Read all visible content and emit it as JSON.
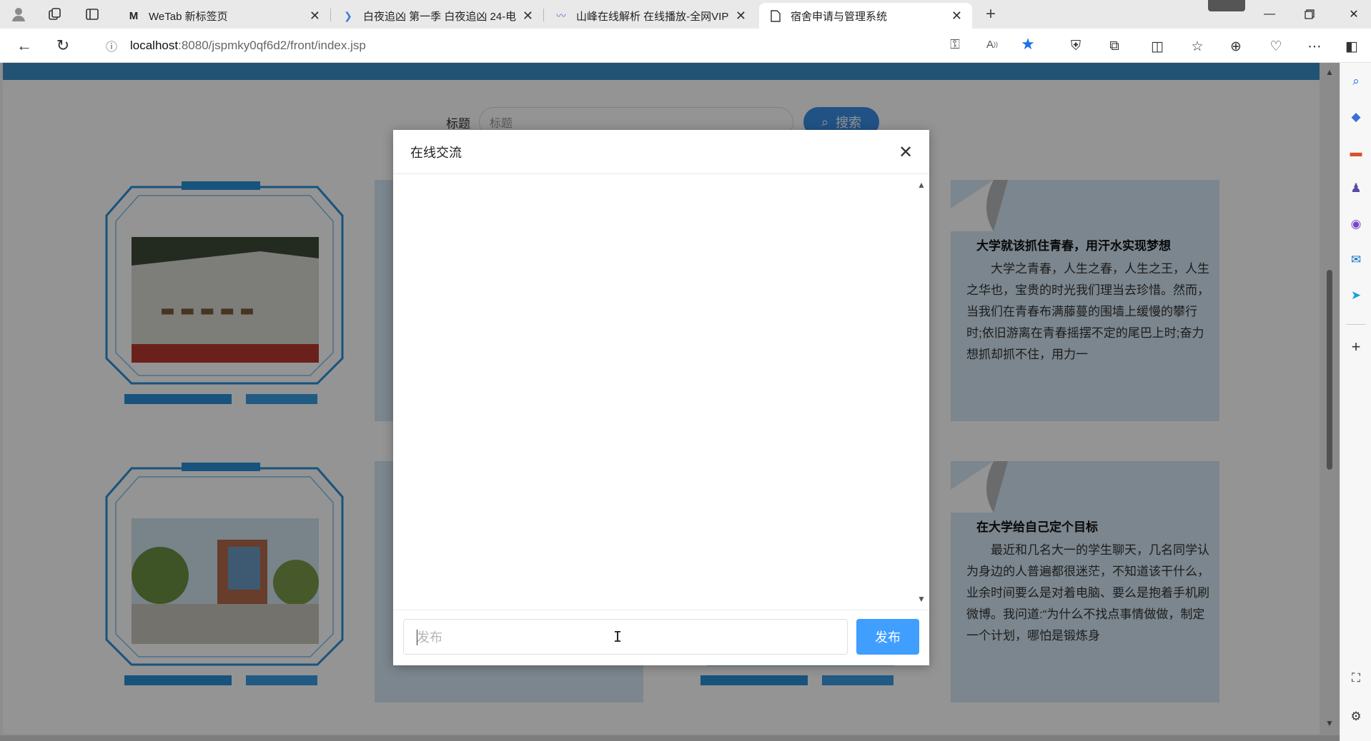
{
  "browser": {
    "tabs": [
      {
        "title": "WeTab 新标签页",
        "icon": "wetab-icon"
      },
      {
        "title": "白夜追凶 第一季 白夜追凶 24-电",
        "icon": "play-icon"
      },
      {
        "title": "山峰在线解析 在线播放-全网VIP",
        "icon": "site-icon"
      },
      {
        "title": "宿舍申请与管理系统",
        "icon": "page-icon"
      }
    ],
    "url_host": "localhost",
    "url_path": ":8080/jspmky0qf6d2/front/index.jsp"
  },
  "page": {
    "search_label": "标题",
    "search_placeholder": "标题",
    "search_button": "搜索",
    "articles": [
      {
        "title": "大学就该抓住青春，用汗水实现梦想",
        "body": "大学之青春，人生之春，人生之王，人生之华也，宝贵的时光我们理当去珍惜。然而，当我们在青春布满藤蔓的围墙上缓慢的攀行时;依旧游离在青春摇摆不定的尾巴上时;奋力想抓却抓不住，用力一"
      },
      {
        "title": "在大学给自己定个目标",
        "body": "最近和几名大一的学生聊天，几名同学认为身边的人普遍都很迷茫，不知道该干什么，业余时间要么是对着电脑、要么是抱着手机刷微博。我问道:“为什么不找点事情做做，制定一个计划，哪怕是锻炼身"
      }
    ]
  },
  "modal": {
    "title": "在线交流",
    "input_placeholder": "发布",
    "send_label": "发布"
  },
  "colors": {
    "primary": "#409eff",
    "strip": "#3b8fc9",
    "card_bg": "#d4e7f5"
  }
}
